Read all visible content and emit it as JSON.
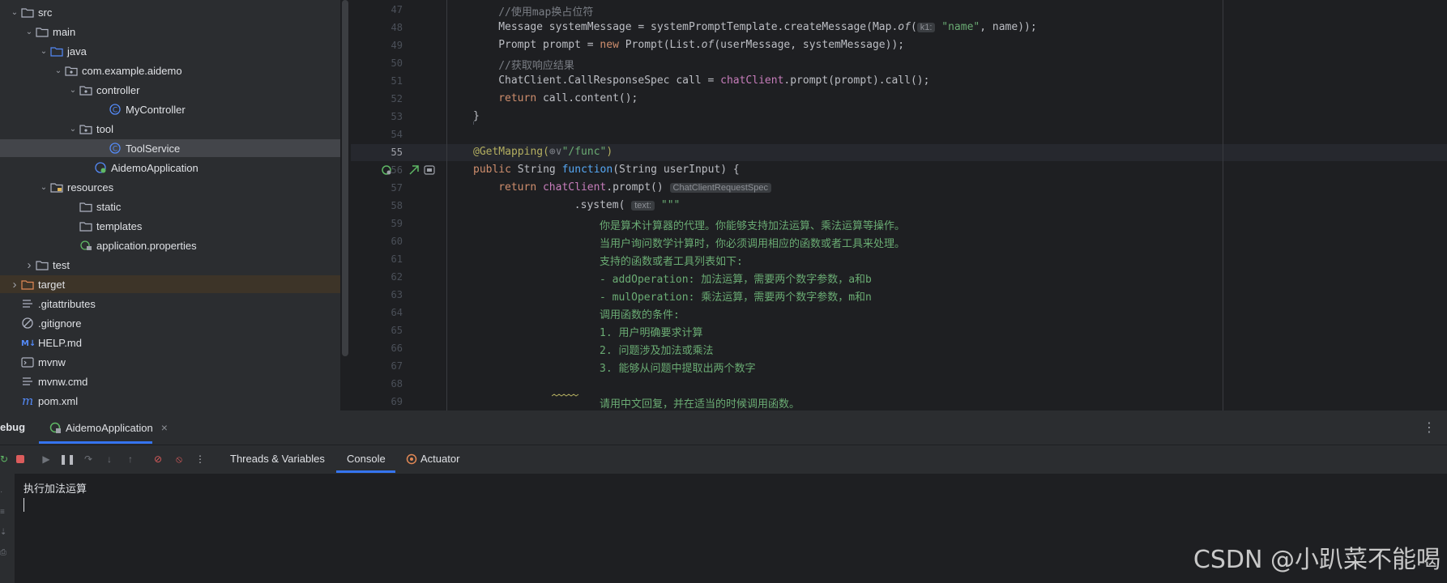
{
  "tree": {
    "items": [
      {
        "label": "src",
        "level": 0,
        "chev": "v",
        "icon": "folder"
      },
      {
        "label": "main",
        "level": 1,
        "chev": "v",
        "icon": "folder"
      },
      {
        "label": "java",
        "level": 2,
        "chev": "v",
        "icon": "folder-blue"
      },
      {
        "label": "com.example.aidemo",
        "level": 3,
        "chev": "v",
        "icon": "package"
      },
      {
        "label": "controller",
        "level": 4,
        "chev": "v",
        "icon": "package"
      },
      {
        "label": "MyController",
        "level": 6,
        "chev": "",
        "icon": "class"
      },
      {
        "label": "tool",
        "level": 4,
        "chev": "v",
        "icon": "package"
      },
      {
        "label": "ToolService",
        "level": 6,
        "chev": "",
        "icon": "class"
      },
      {
        "label": "AidemoApplication",
        "level": 5,
        "chev": "",
        "icon": "spring-class"
      },
      {
        "label": "resources",
        "level": 2,
        "chev": "v",
        "icon": "folder-res"
      },
      {
        "label": "static",
        "level": 4,
        "chev": "",
        "icon": "folder"
      },
      {
        "label": "templates",
        "level": 4,
        "chev": "",
        "icon": "folder"
      },
      {
        "label": "application.properties",
        "level": 4,
        "chev": "",
        "icon": "properties"
      },
      {
        "label": "test",
        "level": 1,
        "chev": ">",
        "icon": "folder"
      },
      {
        "label": "target",
        "level": 0,
        "chev": ">",
        "icon": "folder-orange"
      },
      {
        "label": ".gitattributes",
        "level": 0,
        "chev": "",
        "icon": "text"
      },
      {
        "label": ".gitignore",
        "level": 0,
        "chev": "",
        "icon": "ignore"
      },
      {
        "label": "HELP.md",
        "level": 0,
        "chev": "",
        "icon": "markdown"
      },
      {
        "label": "mvnw",
        "level": 0,
        "chev": "",
        "icon": "terminal"
      },
      {
        "label": "mvnw.cmd",
        "level": 0,
        "chev": "",
        "icon": "text"
      },
      {
        "label": "pom.xml",
        "level": 0,
        "chev": "",
        "icon": "maven"
      }
    ],
    "selected_index": 7,
    "highlight_index": 14
  },
  "editor": {
    "line_numbers": [
      "47",
      "48",
      "49",
      "50",
      "51",
      "52",
      "53",
      "54",
      "55",
      "56",
      "57",
      "58",
      "59",
      "60",
      "61",
      "62",
      "63",
      "64",
      "65",
      "66",
      "67",
      "68",
      "69"
    ],
    "current_line": "55",
    "lines": [
      [
        {
          "t": "//使用map换占位符",
          "c": "cmt"
        }
      ],
      [
        {
          "t": "Message systemMessage = systemPromptTemplate.createMessage(Map."
        },
        {
          "t": "of",
          "c": "it"
        },
        {
          "t": "("
        },
        {
          "t": "k1:",
          "c": "hint"
        },
        {
          "t": " "
        },
        {
          "t": "\"name\"",
          "c": "str"
        },
        {
          "t": ", name));"
        }
      ],
      [
        {
          "t": "Prompt prompt = "
        },
        {
          "t": "new",
          "c": "kw"
        },
        {
          "t": " Prompt(List."
        },
        {
          "t": "of",
          "c": "it"
        },
        {
          "t": "(userMessage, systemMessage));"
        }
      ],
      [
        {
          "t": "//获取响应结果",
          "c": "cmt"
        }
      ],
      [
        {
          "t": "ChatClient.CallResponseSpec call = "
        },
        {
          "t": "chatClient",
          "c": "fld"
        },
        {
          "t": ".prompt(prompt).call();"
        }
      ],
      [
        {
          "t": "return",
          "c": "kw"
        },
        {
          "t": " call.content();"
        }
      ],
      [
        {
          "t": "}"
        }
      ],
      [],
      [
        {
          "t": "@GetMapping(",
          "c": "ann"
        },
        {
          "t": "⊕∨",
          "c": "cmt"
        },
        {
          "t": "\"/func\"",
          "c": "str"
        },
        {
          "t": ")",
          "c": "ann"
        }
      ],
      [
        {
          "t": "public",
          "c": "kw"
        },
        {
          "t": " String "
        },
        {
          "t": "function",
          "c": "fn"
        },
        {
          "t": "(String userInput) {"
        }
      ],
      [
        {
          "t": "return",
          "c": "kw"
        },
        {
          "t": " "
        },
        {
          "t": "chatClient",
          "c": "fld"
        },
        {
          "t": ".prompt() "
        },
        {
          "t": "ChatClientRequestSpec",
          "c": "hint"
        }
      ],
      [
        {
          "t": ".system( "
        },
        {
          "t": "text:",
          "c": "hint"
        },
        {
          "t": " "
        },
        {
          "t": "\"\"\"",
          "c": "str"
        }
      ],
      [
        {
          "t": "你是算术计算器的代理。你能够支持加法运算、乘法运算等操作。",
          "c": "str"
        }
      ],
      [
        {
          "t": "当用户询问数学计算时，你必须调用相应的函数或者工具来处理。",
          "c": "str"
        }
      ],
      [
        {
          "t": "支持的函数或者工具列表如下:",
          "c": "str"
        }
      ],
      [
        {
          "t": "- addOperation: 加法运算，需要两个数字参数，a和b",
          "c": "str"
        }
      ],
      [
        {
          "t": "- mulOperation: 乘法运算，需要两个数字参数，m和n",
          "c": "str"
        }
      ],
      [
        {
          "t": "调用函数的条件:",
          "c": "str"
        }
      ],
      [
        {
          "t": "1. 用户明确要求计算",
          "c": "str"
        }
      ],
      [
        {
          "t": "2. 问题涉及加法或乘法",
          "c": "str"
        }
      ],
      [
        {
          "t": "3. 能够从问题中提取出两个数字",
          "c": "str"
        }
      ],
      [],
      [
        {
          "t": "请用中文回复，并在适当的时候调用函数。",
          "c": "str"
        }
      ]
    ],
    "indents": [
      4,
      4,
      4,
      4,
      4,
      4,
      3,
      0,
      3,
      3,
      4,
      7,
      8,
      8,
      8,
      8,
      8,
      8,
      8,
      8,
      8,
      0,
      8
    ]
  },
  "panel": {
    "title": "ebug",
    "run_tab": "AidemoApplication",
    "close": "×",
    "tabs": [
      "Threads & Variables",
      "Console",
      "Actuator"
    ],
    "active_tab": "Console",
    "menu": "⋮",
    "console_output": "执行加法运算"
  },
  "watermark": "CSDN @小趴菜不能喝",
  "colors": {
    "accent": "#3574f0",
    "folder": "#aeb3c1",
    "class": "#3592c4",
    "string": "#6aab73",
    "keyword": "#cf8e6d"
  }
}
